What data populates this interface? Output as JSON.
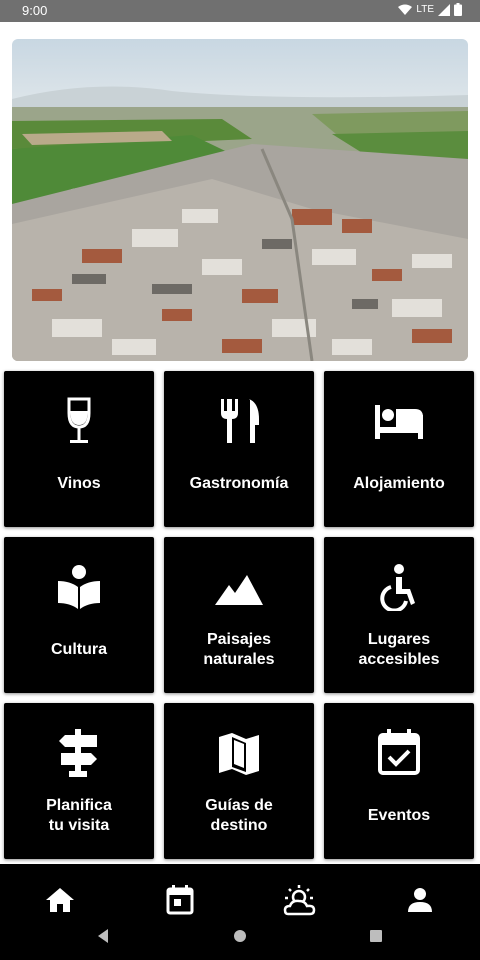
{
  "status_bar": {
    "time": "9:00",
    "network": "LTE",
    "icons": [
      "wifi-icon",
      "cell-signal-icon",
      "battery-icon"
    ]
  },
  "hero": {
    "image": "aerial-town-photo"
  },
  "tiles": [
    {
      "label": "Vinos",
      "icon": "wine-glass-icon"
    },
    {
      "label": "Gastronomía",
      "icon": "restaurant-icon"
    },
    {
      "label": "Alojamiento",
      "icon": "hotel-bed-icon"
    },
    {
      "label": "Cultura",
      "icon": "book-reader-icon"
    },
    {
      "label": "Paisajes\nnaturales",
      "icon": "mountains-icon"
    },
    {
      "label": "Lugares\naccesibles",
      "icon": "accessible-icon"
    },
    {
      "label": "Planifica\ntu visita",
      "icon": "signpost-icon"
    },
    {
      "label": "Guías de\ndestino",
      "icon": "map-icon"
    },
    {
      "label": "Eventos",
      "icon": "calendar-check-icon"
    }
  ],
  "bottom_nav": [
    "home-icon",
    "calendar-icon",
    "weather-icon",
    "person-icon"
  ],
  "system_nav": [
    "back-icon",
    "home-circle-icon",
    "recents-icon"
  ],
  "colors": {
    "tile_bg": "#000000",
    "status_bar": "#707070",
    "text": "#ffffff"
  }
}
